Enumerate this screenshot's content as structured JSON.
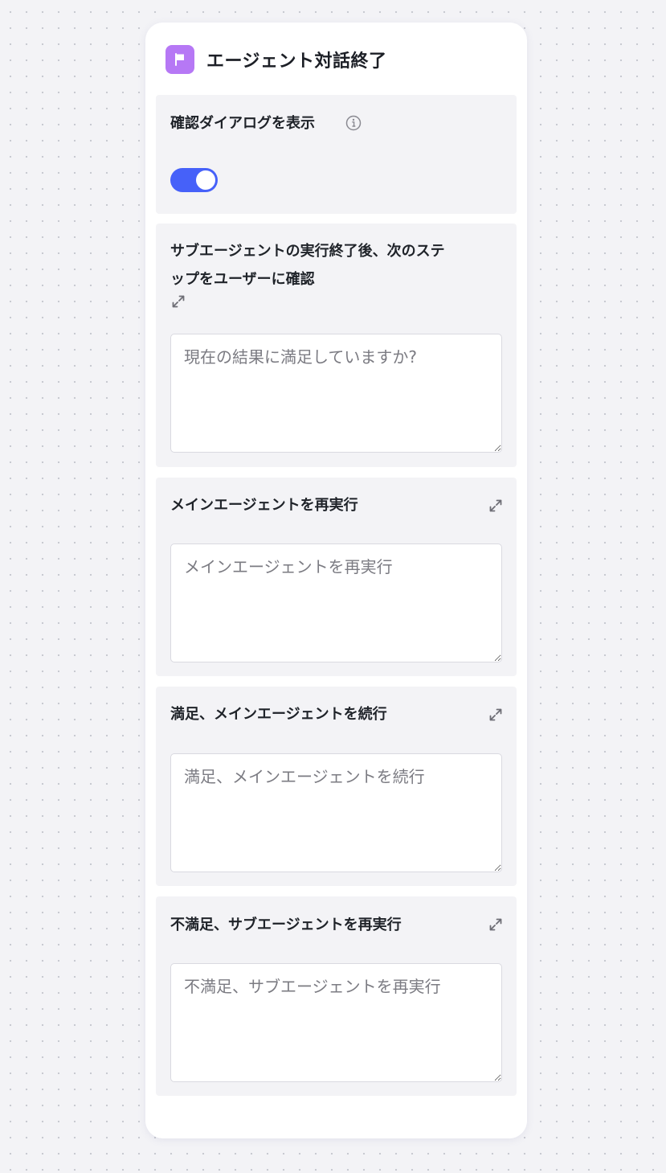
{
  "header": {
    "title": "エージェント対話終了",
    "icon": "flag-icon",
    "icon_color": "#b678f5"
  },
  "confirm_dialog": {
    "label": "確認ダイアログを表示",
    "toggle_on": true,
    "toggle_color": "#4661f9"
  },
  "confirm_question": {
    "label_line1": "サブエージェントの実行終了後、次のステ",
    "label_line2": "ップをユーザーに確認",
    "placeholder": "現在の結果に満足していますか?",
    "value": ""
  },
  "rerun_main": {
    "label": "メインエージェントを再実行",
    "placeholder": "メインエージェントを再実行",
    "value": ""
  },
  "continue_main": {
    "label": "満足、メインエージェントを続行",
    "placeholder": "満足、メインエージェントを続行",
    "value": ""
  },
  "rerun_sub": {
    "label": "不満足、サブエージェントを再実行",
    "placeholder": "不満足、サブエージェントを再実行",
    "value": ""
  }
}
